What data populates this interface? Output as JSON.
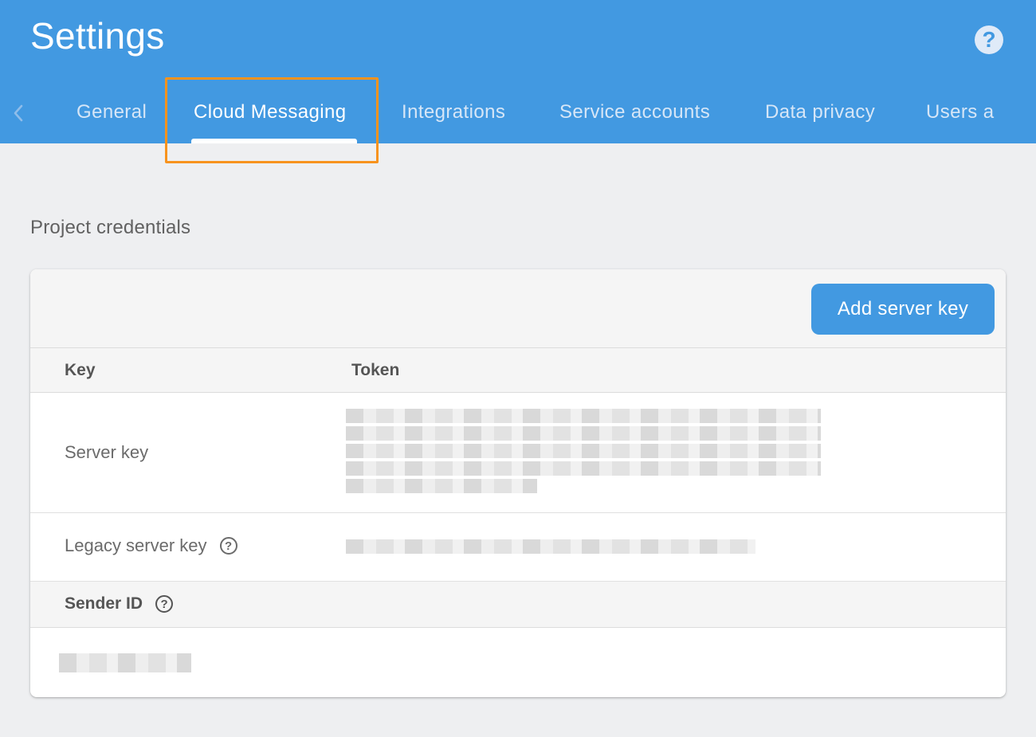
{
  "header": {
    "title": "Settings",
    "help_icon": "help-icon",
    "accent_color": "#4299e1"
  },
  "tabs": [
    {
      "label": "General",
      "active": false
    },
    {
      "label": "Cloud Messaging",
      "active": true
    },
    {
      "label": "Integrations",
      "active": false
    },
    {
      "label": "Service accounts",
      "active": false
    },
    {
      "label": "Data privacy",
      "active": false
    },
    {
      "label": "Users a",
      "active": false
    }
  ],
  "section": {
    "title": "Project credentials"
  },
  "card": {
    "add_button_label": "Add server key",
    "columns": [
      "Key",
      "Token"
    ],
    "rows": [
      {
        "label": "Server key",
        "has_help": false
      },
      {
        "label": "Legacy server key",
        "has_help": true
      }
    ],
    "sender": {
      "label": "Sender ID",
      "has_help": true
    }
  }
}
